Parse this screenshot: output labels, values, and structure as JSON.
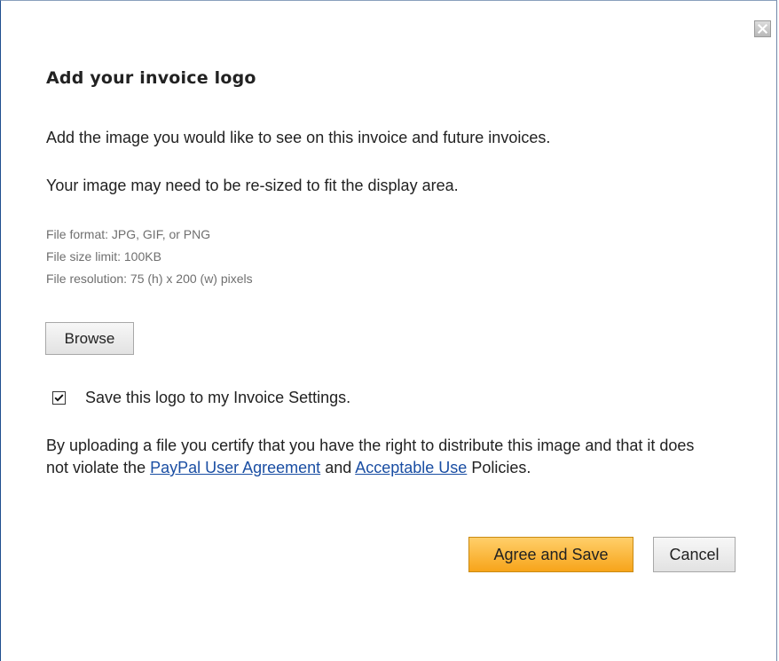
{
  "dialog": {
    "close_icon": "close-icon",
    "title": "Add your invoice logo",
    "intro": "Add the image you would like to see on this invoice and future invoices.",
    "resize_note": "Your image may need to be re-sized to fit the display area.",
    "file_specs": [
      "File format: JPG, GIF, or PNG",
      "File size limit: 100KB",
      "File resolution: 75 (h) x 200 (w) pixels"
    ],
    "browse_label": "Browse",
    "save_logo": {
      "checked": true,
      "label": "Save this logo to my Invoice Settings."
    },
    "legal": {
      "text_before": "By uploading a file you certify that you have the right to distribute this image and that it does not violate the ",
      "user_agreement_link": "PayPal User Agreement",
      "text_middle": " and ",
      "acceptable_use_link": "Acceptable Use",
      "text_after": " Policies."
    },
    "agree_label": "Agree and Save",
    "cancel_label": "Cancel"
  },
  "colors": {
    "primary_button": "#f7a41a",
    "link": "#1a4ea3",
    "secondary_text": "#6f6f6f"
  }
}
